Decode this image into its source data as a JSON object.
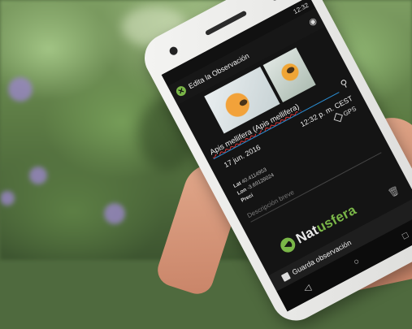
{
  "phone_screen": {
    "status_time": "12:32",
    "app_title": "Edita la Observación",
    "species": "Apis mellifera (Apis mellifera)",
    "date": "17 jun. 2016",
    "time": "12:32 p. m. CEST",
    "gps_label": "GPS",
    "lat_label": "Lat",
    "lat_value": "40.4114953",
    "lon_label": "Lon",
    "lon_value": "-3.69126024",
    "prec_label": "Preci",
    "description_placeholder": "Descripción breve",
    "brand_name_part1": "Nat",
    "brand_name_part2": "usfera",
    "save_label": "Guarda observación"
  },
  "icons": {
    "close": "close-icon",
    "camera": "camera-icon",
    "search": "search-icon",
    "gps": "gps-icon",
    "trash": "trash-icon",
    "save": "save-icon"
  },
  "colors": {
    "accent_green": "#7ab648",
    "screen_bg": "#141414",
    "underline_blue": "#2a8fd6"
  }
}
